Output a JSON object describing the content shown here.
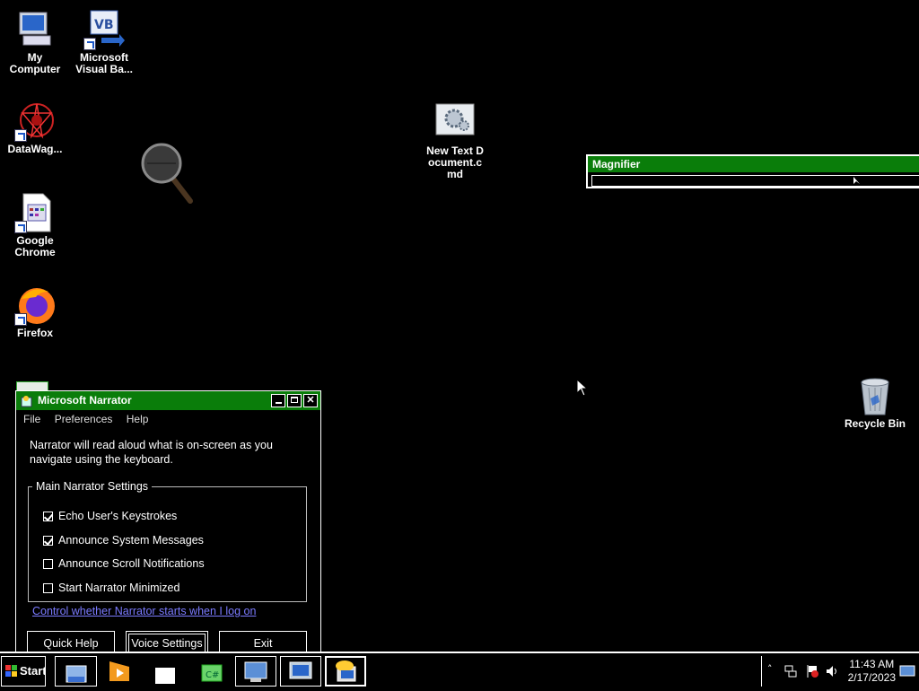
{
  "desktop": {
    "icons": [
      {
        "label": "My Computer",
        "icon": "my-computer-icon"
      },
      {
        "label": "Microsoft Visual Ba...",
        "icon": "visual-basic-icon"
      },
      {
        "label": "DataWag...",
        "icon": "datawag-icon"
      },
      {
        "label": "Google Chrome",
        "icon": "chrome-icon"
      },
      {
        "label": "Firefox",
        "icon": "firefox-icon"
      },
      {
        "label": "New Text Document.cmd",
        "icon": "cmd-file-icon"
      },
      {
        "label": "Recycle Bin",
        "icon": "recycle-bin-icon"
      }
    ]
  },
  "magnifier": {
    "title": "Magnifier"
  },
  "narrator": {
    "title": "Microsoft Narrator",
    "menu": [
      "File",
      "Preferences",
      "Help"
    ],
    "description": "Narrator will read aloud what is on-screen as you navigate using the keyboard.",
    "group_label": "Main Narrator Settings",
    "options": [
      {
        "label": "Echo User's Keystrokes",
        "checked": true
      },
      {
        "label": "Announce System Messages",
        "checked": true
      },
      {
        "label": "Announce Scroll Notifications",
        "checked": false
      },
      {
        "label": "Start Narrator Minimized",
        "checked": false
      }
    ],
    "link": "Control whether Narrator starts when I log on",
    "buttons": {
      "help": "Quick Help",
      "voice": "Voice Settings",
      "exit": "Exit"
    }
  },
  "taskbar": {
    "start_label": "Start",
    "clock_time": "11:43 AM",
    "clock_date": "2/17/2023"
  },
  "colors": {
    "titlebar": "#0a7d0a",
    "background": "#000000",
    "link": "#7b7bff"
  }
}
